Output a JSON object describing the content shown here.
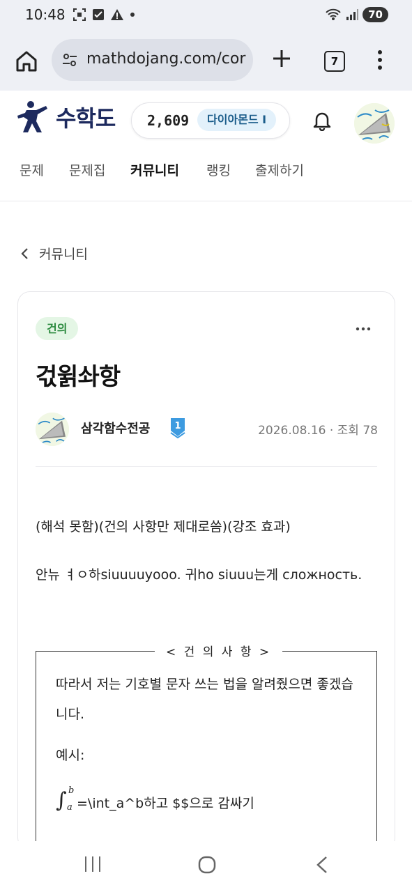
{
  "status_bar": {
    "time": "10:48",
    "battery": "70",
    "left_icons": [
      "screenshot-icon",
      "checkbox-icon",
      "warning-icon",
      "dot-icon"
    ],
    "right_icons": [
      "wifi-icon",
      "signal-icon",
      "battery-icon"
    ]
  },
  "browser": {
    "url": "mathdojang.com/cor",
    "tab_count": "7",
    "icons": [
      "home-icon",
      "site-settings-icon",
      "plus-icon",
      "tabs-icon",
      "more-vert-icon"
    ]
  },
  "header": {
    "logo_text": "수학도",
    "points": "2,609",
    "tier": "다이아몬드 I",
    "icons": [
      "logo-fighter-icon",
      "bell-icon",
      "avatar"
    ]
  },
  "nav": {
    "items": [
      {
        "label": "문제",
        "active": false
      },
      {
        "label": "문제집",
        "active": false
      },
      {
        "label": "커뮤니티",
        "active": true
      },
      {
        "label": "랭킹",
        "active": false
      },
      {
        "label": "출제하기",
        "active": false
      }
    ]
  },
  "breadcrumb": {
    "label": "커뮤니티"
  },
  "post": {
    "tag": "건의",
    "title": "걳윍솨항",
    "author": "삼각함수전공",
    "level": "1",
    "date": "2026.08.16",
    "views": "조회 78",
    "meta_sep": "·",
    "paragraph1": "(해석 못함)(건의 사항만 제대로씀)(강조 효과)",
    "paragraph2": "안뉴 ㅕㅇ하siuuuuyooo. 귀ho siuuu는게 сложность.",
    "box": {
      "legend": "< 건 의 사 항 >",
      "line1": "따라서 저는 기호별 문자 쓰는 법을 알려줬으면 좋겠습니다.",
      "line2": "예시:",
      "integral_upper": "b",
      "integral_lower": "a",
      "integral_symbol": "∫",
      "line3": " =\\int_a^b하고 $$으로 감싸기"
    }
  },
  "colors": {
    "brand": "#1d2a5e",
    "tag_bg": "#e4f6e5",
    "tag_fg": "#2b8a3e",
    "tier_bg": "#e3f1fb",
    "tier_fg": "#1a5c8a",
    "level_badge": "#3d9be0"
  },
  "system_nav": {
    "icons": [
      "recent-apps-icon",
      "home-circle-icon",
      "back-icon"
    ]
  }
}
